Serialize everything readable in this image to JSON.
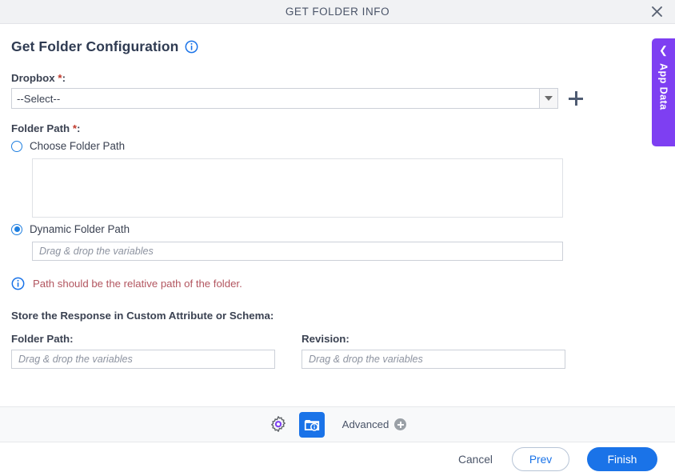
{
  "window": {
    "title": "GET FOLDER INFO",
    "close_icon": "close-icon"
  },
  "page": {
    "title": "Get Folder Configuration",
    "title_info_icon": "info-icon"
  },
  "form": {
    "dropbox": {
      "label": "Dropbox",
      "required_marker": "*",
      "colon": ":",
      "selected_value": "--Select--",
      "dropdown_icon": "chevron-down-icon",
      "add_icon": "plus-icon"
    },
    "folder_path": {
      "label": "Folder Path",
      "required_marker": "*",
      "colon": ":",
      "choose_option_label": "Choose Folder Path",
      "choose_option_selected": false,
      "dynamic_option_label": "Dynamic Folder Path",
      "dynamic_option_selected": true,
      "choose_textarea_value": "",
      "dynamic_input_placeholder": "Drag & drop the variables",
      "dynamic_input_value": ""
    },
    "note": {
      "icon": "info-icon",
      "text": "Path should be the relative path of the folder.",
      "color": "#b2555f"
    },
    "store_section": {
      "label": "Store the Response in Custom Attribute or Schema:",
      "fields": [
        {
          "label": "Folder Path:",
          "placeholder": "Drag & drop the variables",
          "value": ""
        },
        {
          "label": "Revision:",
          "placeholder": "Drag & drop the variables",
          "value": ""
        }
      ]
    }
  },
  "app_data_tab": {
    "label": "App Data",
    "chevron_icon": "chevron-left-icon",
    "color": "#7e3ff2"
  },
  "toolbar": {
    "settings_icon": "gear-icon",
    "folder_info_icon": "folder-info-icon",
    "advanced_label": "Advanced",
    "advanced_add_icon": "plus-circle-icon",
    "active_tile_color": "#1a73e8"
  },
  "footer": {
    "cancel_label": "Cancel",
    "prev_label": "Prev",
    "finish_label": "Finish",
    "primary_color": "#1a73e8"
  }
}
